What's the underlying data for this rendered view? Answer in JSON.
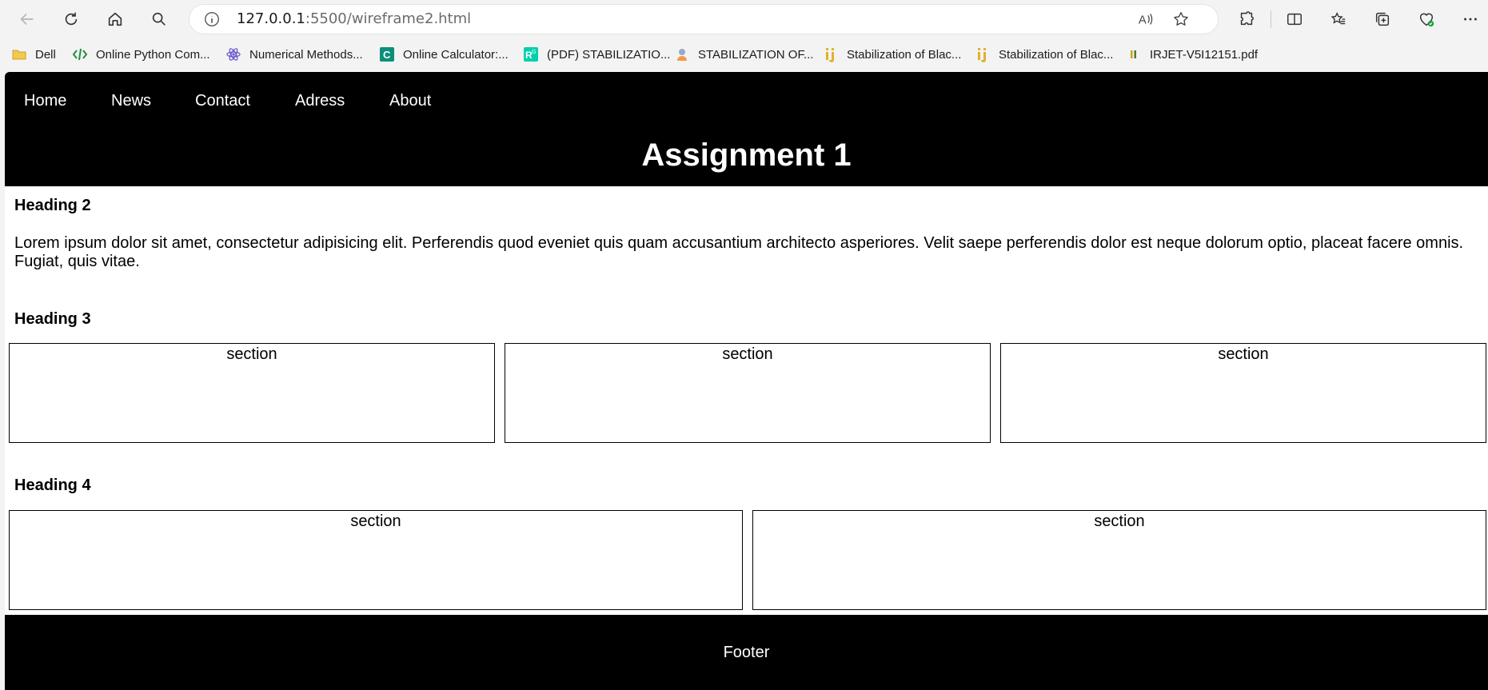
{
  "browser": {
    "url_host": "127.0.0.1",
    "url_rest": ":5500/wireframe2.html",
    "bookmarks": [
      {
        "label": "Dell",
        "icon": "folder-icon"
      },
      {
        "label": "Online Python Com...",
        "icon": "code-icon"
      },
      {
        "label": "Numerical Methods...",
        "icon": "atom-icon"
      },
      {
        "label": "Online Calculator:...",
        "icon": "calculator-c-icon"
      },
      {
        "label": "(PDF) STABILIZATIO...",
        "icon": "researchgate-icon"
      },
      {
        "label": "STABILIZATION OF...",
        "icon": "site-icon"
      },
      {
        "label": "Stabilization of Blac...",
        "icon": "ij-icon"
      },
      {
        "label": "Stabilization of Blac...",
        "icon": "ij-icon"
      },
      {
        "label": "IRJET-V5I12151.pdf",
        "icon": "pdf-icon"
      }
    ]
  },
  "page": {
    "nav": [
      "Home",
      "News",
      "Contact",
      "Adress",
      "About"
    ],
    "title": "Assignment 1",
    "heading2": "Heading 2",
    "paragraph": "Lorem ipsum dolor sit amet, consectetur adipisicing elit. Perferendis quod eveniet quis quam accusantium architecto asperiores. Velit saepe perferendis dolor est neque dolorum optio, placeat facere omnis. Fugiat, quis vitae.",
    "heading3": "Heading 3",
    "row1_sections": [
      "section",
      "section",
      "section"
    ],
    "heading4": "Heading 4",
    "row2_sections": [
      "section",
      "section"
    ],
    "footer": "Footer"
  },
  "colors": {
    "header_bg": "#000000",
    "footer_bg": "#000000",
    "chrome_bg": "#f3f3f3"
  }
}
